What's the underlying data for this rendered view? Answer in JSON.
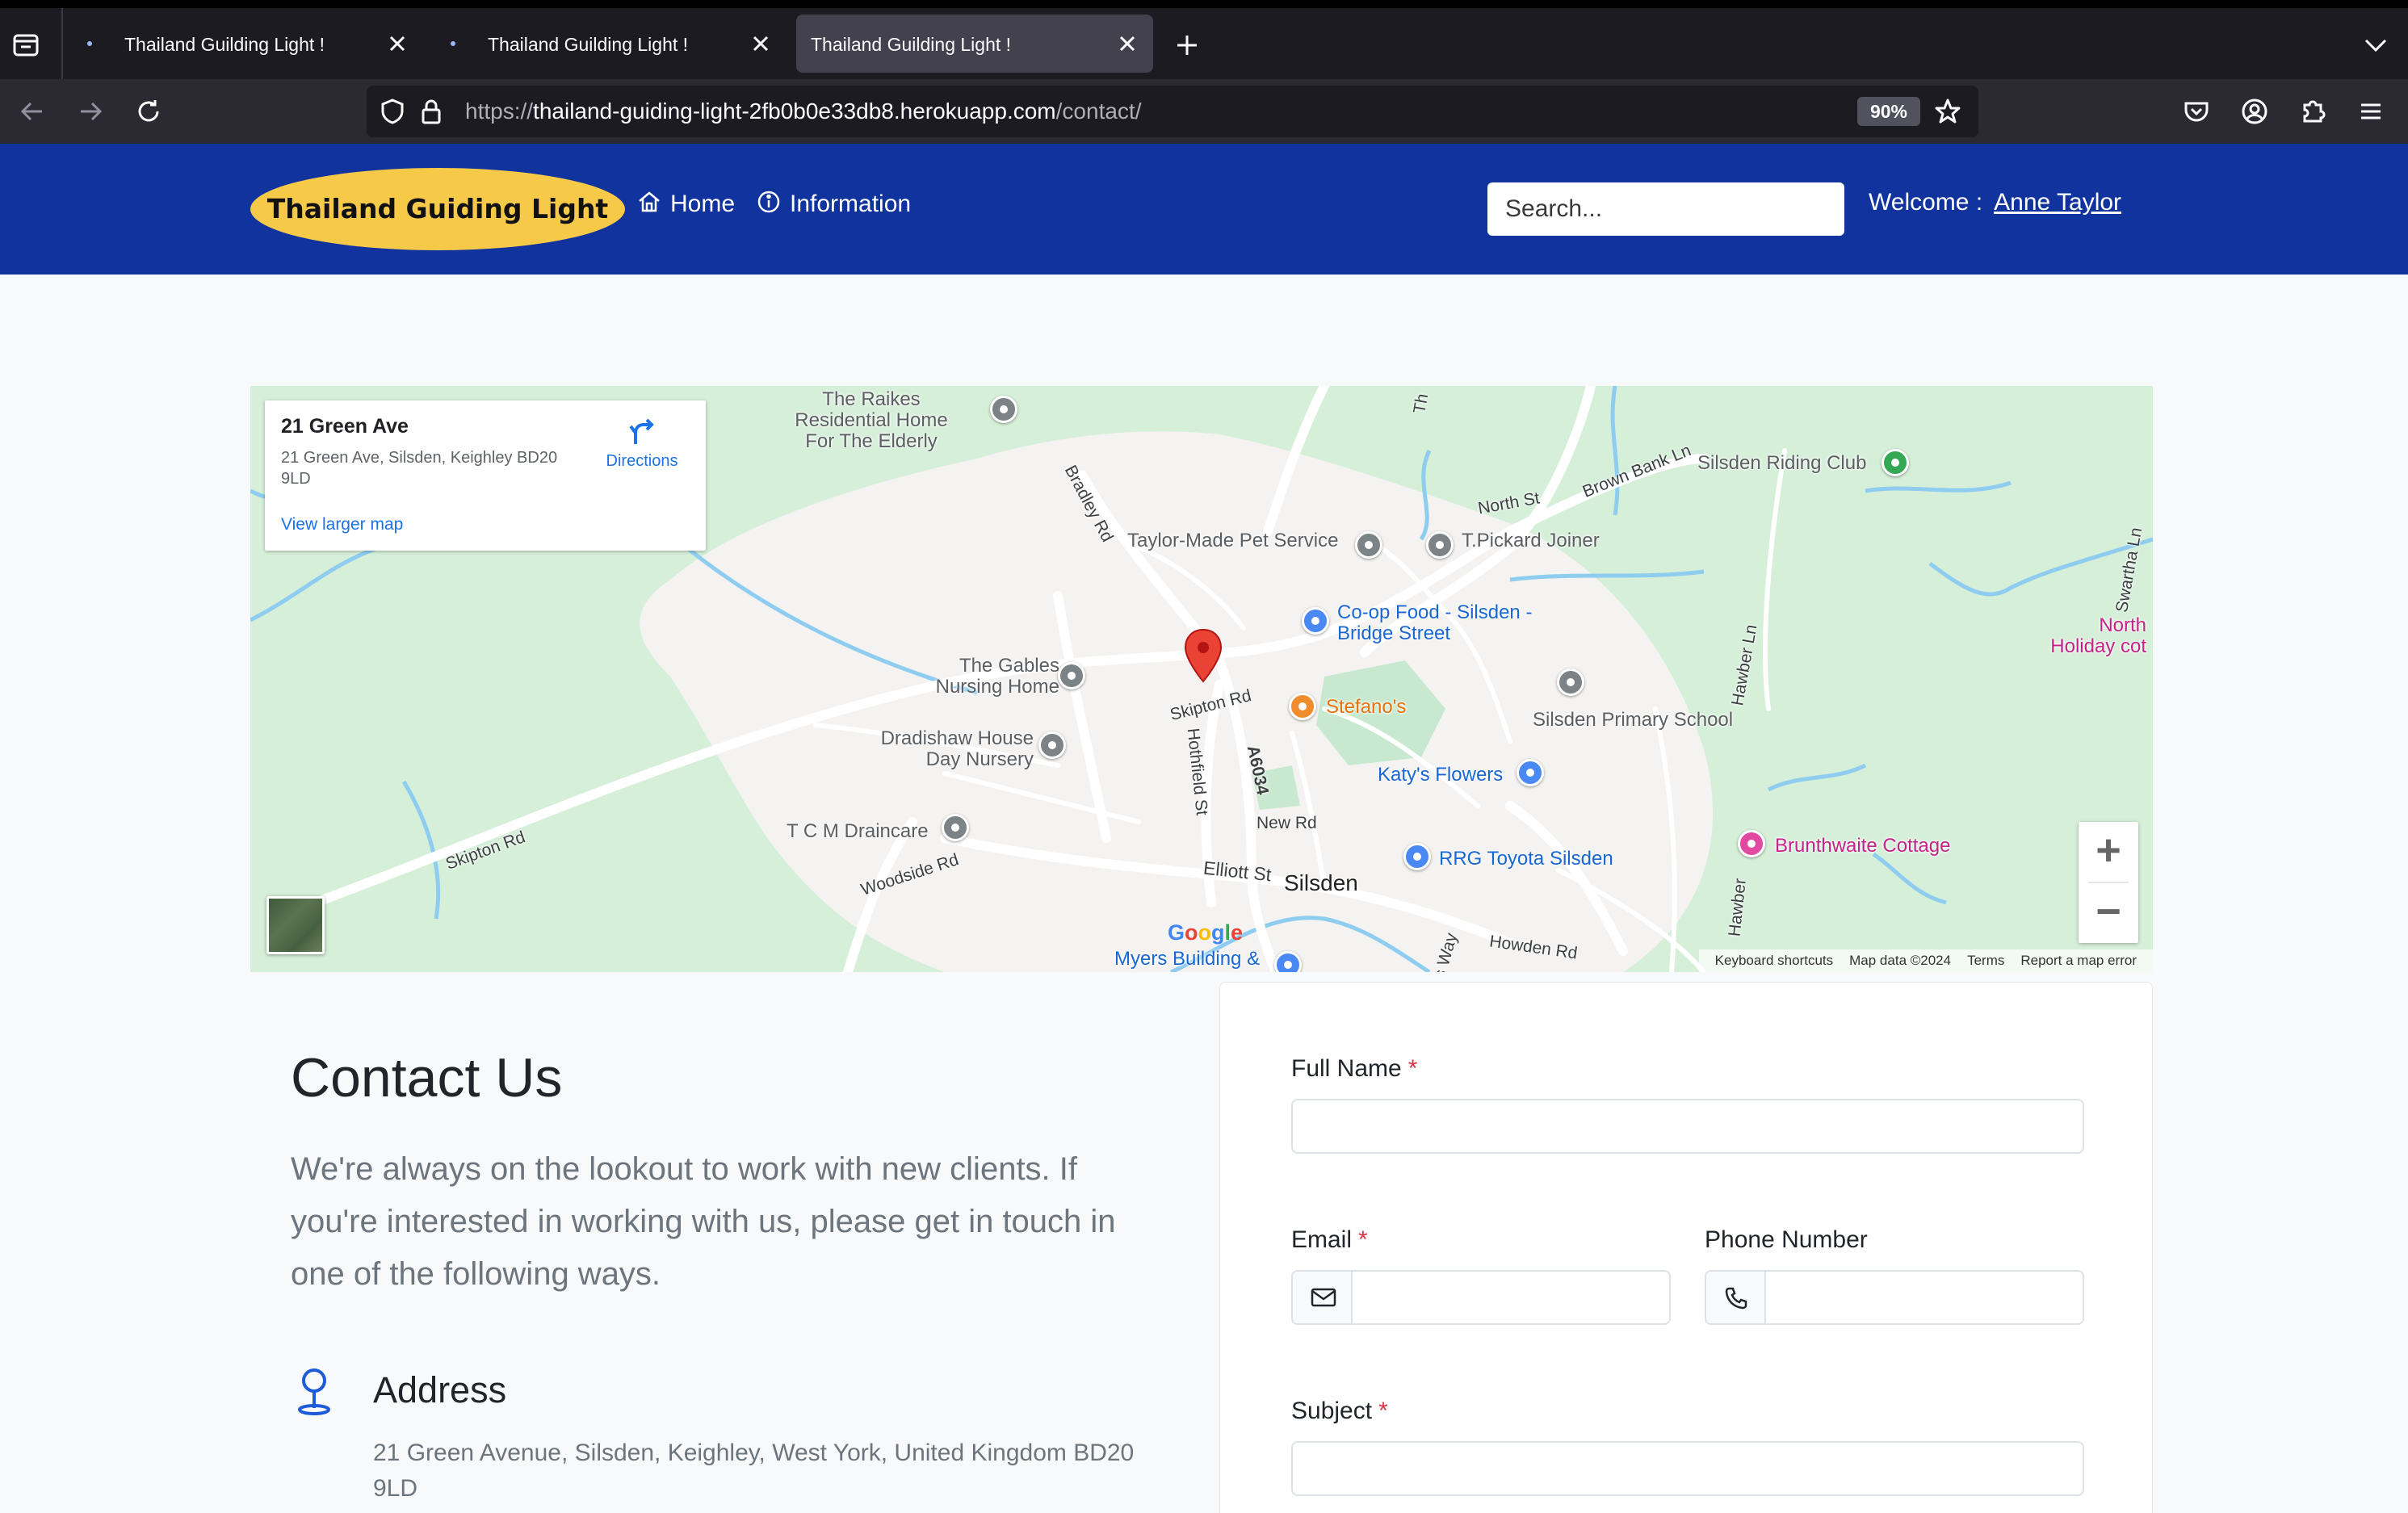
{
  "browser": {
    "tabs": [
      {
        "title": "Thailand Guilding Light !",
        "active": false
      },
      {
        "title": "Thailand Guilding Light !",
        "active": false
      },
      {
        "title": "Thailand Guilding Light !",
        "active": true
      }
    ],
    "url_prefix": "https://",
    "url_host": "thailand-guiding-light-2fb0b0e33db8.herokuapp.com",
    "url_path": "/contact/",
    "zoom": "90%"
  },
  "header": {
    "logo": "Thailand Guiding Light",
    "nav": [
      {
        "label": "Home",
        "icon": "house-icon"
      },
      {
        "label": "Information",
        "icon": "info-circle-icon"
      }
    ],
    "search_placeholder": "Search...",
    "welcome_label": "Welcome :",
    "user_name": "Anne Taylor",
    "colors": {
      "header_bg": "#11339e",
      "logo_bg": "#f7c948"
    }
  },
  "map": {
    "card": {
      "title": "21 Green Ave",
      "address": "21 Green Ave, Silsden, Keighley BD20 9LD",
      "directions": "Directions",
      "larger_map": "View larger map"
    },
    "places": {
      "raikes": "The Raikes Residential Home For The Elderly",
      "taylor_made": "Taylor-Made Pet Service",
      "pickard": "T.Pickard Joiner",
      "riding_club": "Silsden Riding Club",
      "coop": "Co-op Food - Silsden - Bridge Street",
      "gables": "The Gables Nursing Home",
      "stefanos": "Stefano's",
      "primary_school": "Silsden Primary School",
      "dradishaw": "Dradishaw House Day Nursery",
      "katys": "Katy's Flowers",
      "tcm": "T C M Draincare",
      "rrg": "RRG Toyota Silsden",
      "brunthwaite": "Brunthwaite Cottage",
      "north_holiday": "North Holiday cot",
      "silsden": "Silsden",
      "myers": "Myers Building &"
    },
    "roads": {
      "bradley": "Bradley Rd",
      "north_st": "North St",
      "brown_bank": "Brown Bank Ln",
      "swartha": "Swartha Ln",
      "hawber": "Hawber Ln",
      "skipton_rd_1": "Skipton Rd",
      "skipton_rd_2": "Skipton Rd",
      "hothfield": "Hothfield St",
      "a6034": "A6034",
      "new_rd": "New Rd",
      "elliott": "Elliott St",
      "woodside": "Woodside Rd",
      "howden": "Howden Rd",
      "hawber_2": "Hawber",
      "th": "Th",
      "way": "s Way"
    },
    "google": "Google",
    "attribution": [
      "Keyboard shortcuts",
      "Map data ©2024",
      "Terms",
      "Report a map error"
    ]
  },
  "contact": {
    "title": "Contact Us",
    "intro": "We're always on the lookout to work with new clients. If you're interested in working with us, please get in touch in one of the following ways.",
    "address_title": "Address",
    "address": "21 Green Avenue, Silsden, Keighley, West York, United Kingdom BD20 9LD"
  },
  "form": {
    "full_name_label": "Full Name",
    "email_label": "Email",
    "phone_label": "Phone Number",
    "subject_label": "Subject",
    "required_mark": "*"
  }
}
